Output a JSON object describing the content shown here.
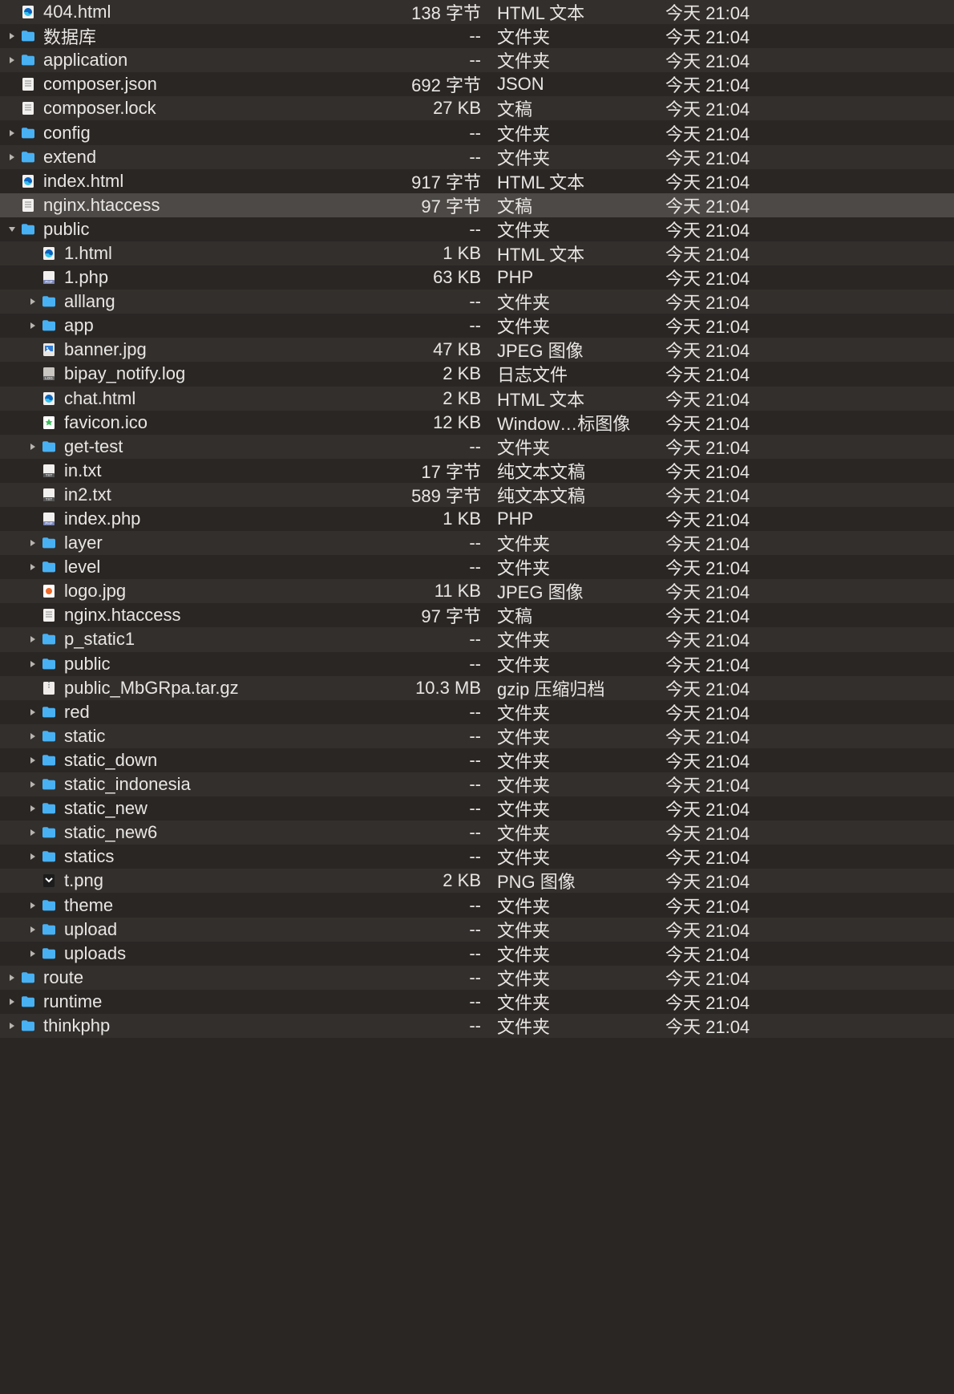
{
  "rows": [
    {
      "indent": 1,
      "disclosure": "",
      "icon": "edge",
      "name": "404.html",
      "size": "138 字节",
      "kind": "HTML 文本",
      "date": "今天 21:04"
    },
    {
      "indent": 1,
      "disclosure": "right",
      "icon": "folder",
      "name": "数据库",
      "size": "--",
      "kind": "文件夹",
      "date": "今天 21:04"
    },
    {
      "indent": 1,
      "disclosure": "right",
      "icon": "folder",
      "name": "application",
      "size": "--",
      "kind": "文件夹",
      "date": "今天 21:04"
    },
    {
      "indent": 1,
      "disclosure": "",
      "icon": "doc",
      "name": "composer.json",
      "size": "692 字节",
      "kind": "JSON",
      "date": "今天 21:04"
    },
    {
      "indent": 1,
      "disclosure": "",
      "icon": "doc",
      "name": "composer.lock",
      "size": "27 KB",
      "kind": "文稿",
      "date": "今天 21:04"
    },
    {
      "indent": 1,
      "disclosure": "right",
      "icon": "folder",
      "name": "config",
      "size": "--",
      "kind": "文件夹",
      "date": "今天 21:04"
    },
    {
      "indent": 1,
      "disclosure": "right",
      "icon": "folder",
      "name": "extend",
      "size": "--",
      "kind": "文件夹",
      "date": "今天 21:04"
    },
    {
      "indent": 1,
      "disclosure": "",
      "icon": "edge",
      "name": "index.html",
      "size": "917 字节",
      "kind": "HTML 文本",
      "date": "今天 21:04"
    },
    {
      "indent": 1,
      "disclosure": "",
      "icon": "doc",
      "name": "nginx.htaccess",
      "size": "97 字节",
      "kind": "文稿",
      "date": "今天 21:04",
      "selected": true
    },
    {
      "indent": 1,
      "disclosure": "down",
      "icon": "folder",
      "name": "public",
      "size": "--",
      "kind": "文件夹",
      "date": "今天 21:04"
    },
    {
      "indent": 2,
      "disclosure": "",
      "icon": "edge",
      "name": "1.html",
      "size": "1 KB",
      "kind": "HTML 文本",
      "date": "今天 21:04"
    },
    {
      "indent": 2,
      "disclosure": "",
      "icon": "php",
      "name": "1.php",
      "size": "63 KB",
      "kind": "PHP",
      "date": "今天 21:04"
    },
    {
      "indent": 2,
      "disclosure": "right",
      "icon": "folder",
      "name": "alllang",
      "size": "--",
      "kind": "文件夹",
      "date": "今天 21:04"
    },
    {
      "indent": 2,
      "disclosure": "right",
      "icon": "folder",
      "name": "app",
      "size": "--",
      "kind": "文件夹",
      "date": "今天 21:04"
    },
    {
      "indent": 2,
      "disclosure": "",
      "icon": "jpg",
      "name": "banner.jpg",
      "size": "47 KB",
      "kind": "JPEG 图像",
      "date": "今天 21:04"
    },
    {
      "indent": 2,
      "disclosure": "",
      "icon": "log",
      "name": "bipay_notify.log",
      "size": "2 KB",
      "kind": "日志文件",
      "date": "今天 21:04"
    },
    {
      "indent": 2,
      "disclosure": "",
      "icon": "edge",
      "name": "chat.html",
      "size": "2 KB",
      "kind": "HTML 文本",
      "date": "今天 21:04"
    },
    {
      "indent": 2,
      "disclosure": "",
      "icon": "ico",
      "name": "favicon.ico",
      "size": "12 KB",
      "kind": "Window…标图像",
      "date": "今天 21:04"
    },
    {
      "indent": 2,
      "disclosure": "right",
      "icon": "folder",
      "name": "get-test",
      "size": "--",
      "kind": "文件夹",
      "date": "今天 21:04"
    },
    {
      "indent": 2,
      "disclosure": "",
      "icon": "txt",
      "name": "in.txt",
      "size": "17 字节",
      "kind": "纯文本文稿",
      "date": "今天 21:04"
    },
    {
      "indent": 2,
      "disclosure": "",
      "icon": "txt",
      "name": "in2.txt",
      "size": "589 字节",
      "kind": "纯文本文稿",
      "date": "今天 21:04"
    },
    {
      "indent": 2,
      "disclosure": "",
      "icon": "php",
      "name": "index.php",
      "size": "1 KB",
      "kind": "PHP",
      "date": "今天 21:04"
    },
    {
      "indent": 2,
      "disclosure": "right",
      "icon": "folder",
      "name": "layer",
      "size": "--",
      "kind": "文件夹",
      "date": "今天 21:04"
    },
    {
      "indent": 2,
      "disclosure": "right",
      "icon": "folder",
      "name": "level",
      "size": "--",
      "kind": "文件夹",
      "date": "今天 21:04"
    },
    {
      "indent": 2,
      "disclosure": "",
      "icon": "logo",
      "name": "logo.jpg",
      "size": "11 KB",
      "kind": "JPEG 图像",
      "date": "今天 21:04"
    },
    {
      "indent": 2,
      "disclosure": "",
      "icon": "doc",
      "name": "nginx.htaccess",
      "size": "97 字节",
      "kind": "文稿",
      "date": "今天 21:04"
    },
    {
      "indent": 2,
      "disclosure": "right",
      "icon": "folder",
      "name": "p_static1",
      "size": "--",
      "kind": "文件夹",
      "date": "今天 21:04"
    },
    {
      "indent": 2,
      "disclosure": "right",
      "icon": "folder",
      "name": "public",
      "size": "--",
      "kind": "文件夹",
      "date": "今天 21:04"
    },
    {
      "indent": 2,
      "disclosure": "",
      "icon": "gz",
      "name": "public_MbGRpa.tar.gz",
      "size": "10.3 MB",
      "kind": "gzip 压缩归档",
      "date": "今天 21:04"
    },
    {
      "indent": 2,
      "disclosure": "right",
      "icon": "folder",
      "name": "red",
      "size": "--",
      "kind": "文件夹",
      "date": "今天 21:04"
    },
    {
      "indent": 2,
      "disclosure": "right",
      "icon": "folder",
      "name": "static",
      "size": "--",
      "kind": "文件夹",
      "date": "今天 21:04"
    },
    {
      "indent": 2,
      "disclosure": "right",
      "icon": "folder",
      "name": "static_down",
      "size": "--",
      "kind": "文件夹",
      "date": "今天 21:04"
    },
    {
      "indent": 2,
      "disclosure": "right",
      "icon": "folder",
      "name": "static_indonesia",
      "size": "--",
      "kind": "文件夹",
      "date": "今天 21:04"
    },
    {
      "indent": 2,
      "disclosure": "right",
      "icon": "folder",
      "name": "static_new",
      "size": "--",
      "kind": "文件夹",
      "date": "今天 21:04"
    },
    {
      "indent": 2,
      "disclosure": "right",
      "icon": "folder",
      "name": "static_new6",
      "size": "--",
      "kind": "文件夹",
      "date": "今天 21:04"
    },
    {
      "indent": 2,
      "disclosure": "right",
      "icon": "folder",
      "name": "statics",
      "size": "--",
      "kind": "文件夹",
      "date": "今天 21:04"
    },
    {
      "indent": 2,
      "disclosure": "",
      "icon": "png",
      "name": "t.png",
      "size": "2 KB",
      "kind": "PNG 图像",
      "date": "今天 21:04"
    },
    {
      "indent": 2,
      "disclosure": "right",
      "icon": "folder",
      "name": "theme",
      "size": "--",
      "kind": "文件夹",
      "date": "今天 21:04"
    },
    {
      "indent": 2,
      "disclosure": "right",
      "icon": "folder",
      "name": "upload",
      "size": "--",
      "kind": "文件夹",
      "date": "今天 21:04"
    },
    {
      "indent": 2,
      "disclosure": "right",
      "icon": "folder",
      "name": "uploads",
      "size": "--",
      "kind": "文件夹",
      "date": "今天 21:04"
    },
    {
      "indent": 1,
      "disclosure": "right",
      "icon": "folder",
      "name": "route",
      "size": "--",
      "kind": "文件夹",
      "date": "今天 21:04"
    },
    {
      "indent": 1,
      "disclosure": "right",
      "icon": "folder",
      "name": "runtime",
      "size": "--",
      "kind": "文件夹",
      "date": "今天 21:04"
    },
    {
      "indent": 1,
      "disclosure": "right",
      "icon": "folder",
      "name": "thinkphp",
      "size": "--",
      "kind": "文件夹",
      "date": "今天 21:04"
    }
  ]
}
